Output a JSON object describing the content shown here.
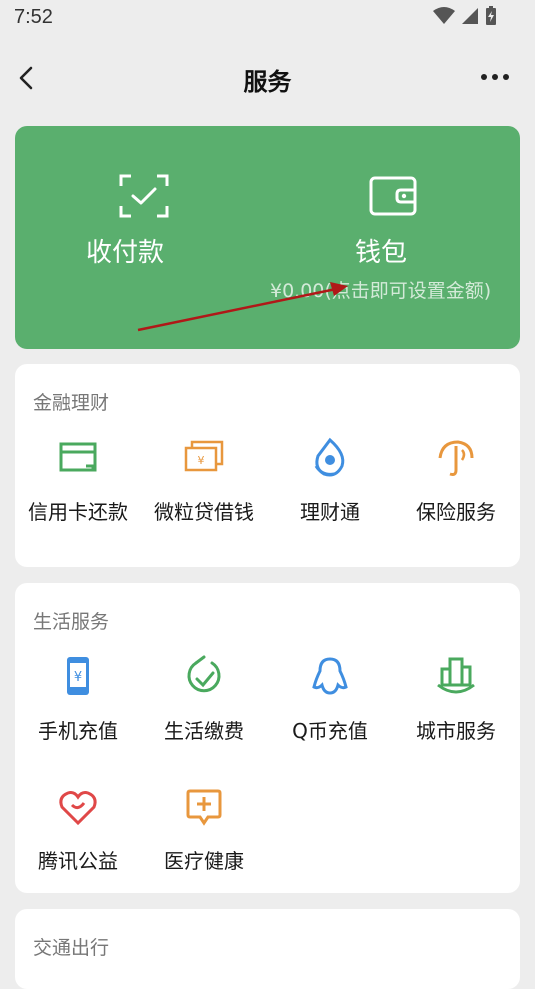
{
  "status_bar": {
    "time": "7:52"
  },
  "nav": {
    "title": "服务"
  },
  "hero": {
    "pay_label": "收付款",
    "wallet_label": "钱包",
    "wallet_balance": "¥0.00(点击即可设置金额)"
  },
  "sections": [
    {
      "title": "金融理财",
      "items": [
        {
          "label": "信用卡还款",
          "icon": "credit-card-icon",
          "color": "#4aa95e"
        },
        {
          "label": "微粒贷借钱",
          "icon": "money-bills-icon",
          "color": "#e8973d"
        },
        {
          "label": "理财通",
          "icon": "wealth-drop-icon",
          "color": "#3f8ee0"
        },
        {
          "label": "保险服务",
          "icon": "umbrella-icon",
          "color": "#e8973d"
        }
      ]
    },
    {
      "title": "生活服务",
      "items": [
        {
          "label": "手机充值",
          "icon": "phone-topup-icon",
          "color": "#3f8ee0"
        },
        {
          "label": "生活缴费",
          "icon": "bill-payment-icon",
          "color": "#4aa95e"
        },
        {
          "label": "Q币充值",
          "icon": "qq-penguin-icon",
          "color": "#3f8ee0"
        },
        {
          "label": "城市服务",
          "icon": "city-buildings-icon",
          "color": "#4aa95e"
        },
        {
          "label": "腾讯公益",
          "icon": "charity-heart-icon",
          "color": "#e04848"
        },
        {
          "label": "医疗健康",
          "icon": "medical-chat-icon",
          "color": "#e8973d"
        }
      ]
    },
    {
      "title": "交通出行"
    }
  ],
  "colors": {
    "hero_green": "#5aaf6e",
    "annotation_arrow": "#b01818"
  }
}
